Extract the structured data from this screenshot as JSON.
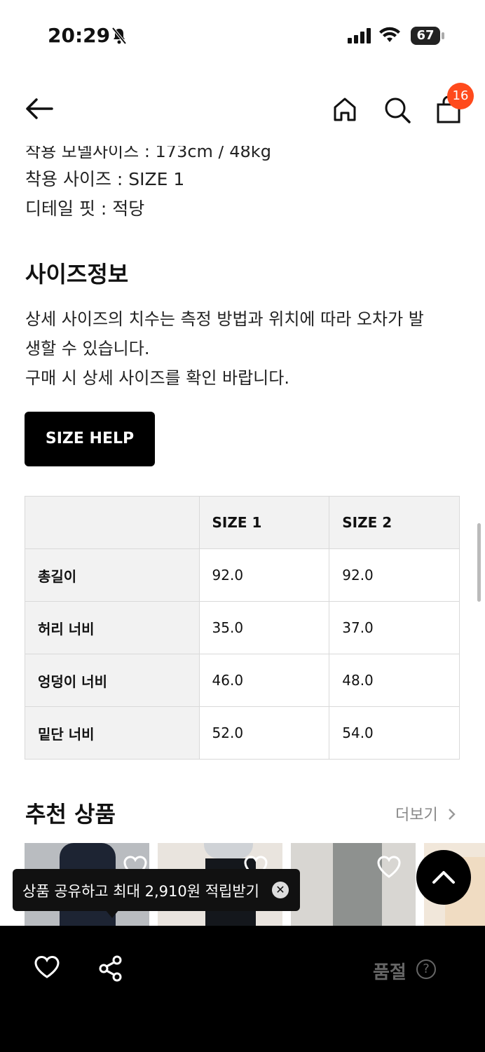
{
  "status_bar": {
    "time": "20:29",
    "battery": "67"
  },
  "header": {
    "cart_count": "16"
  },
  "details": {
    "partial_line": "착용 모델사이즈 : 173cm / 48kg",
    "wear_size": "착용 사이즈 : SIZE 1",
    "detail_fit": "디테일 핏 : 적당"
  },
  "size_info": {
    "title": "사이즈정보",
    "description_line1": "상세 사이즈의 치수는 측정 방법과 위치에 따라 오차가 발",
    "description_line2": "생할 수 있습니다.",
    "description_line3": "구매 시 상세 사이즈를 확인 바랍니다.",
    "size_help_label": "SIZE HELP"
  },
  "size_table": {
    "headers": [
      "",
      "SIZE 1",
      "SIZE 2"
    ],
    "rows": [
      {
        "label": "총길이",
        "size1": "92.0",
        "size2": "92.0"
      },
      {
        "label": "허리 너비",
        "size1": "35.0",
        "size2": "37.0"
      },
      {
        "label": "엉덩이 너비",
        "size1": "46.0",
        "size2": "48.0"
      },
      {
        "label": "밑단 너비",
        "size1": "52.0",
        "size2": "54.0"
      }
    ]
  },
  "recommended": {
    "title": "추천 상품",
    "more_label": "더보기"
  },
  "tooltip": {
    "text": "상품 공유하고 최대 2,910원 적립받기"
  },
  "bottom_bar": {
    "soldout_label": "품절",
    "help_mark": "?"
  }
}
